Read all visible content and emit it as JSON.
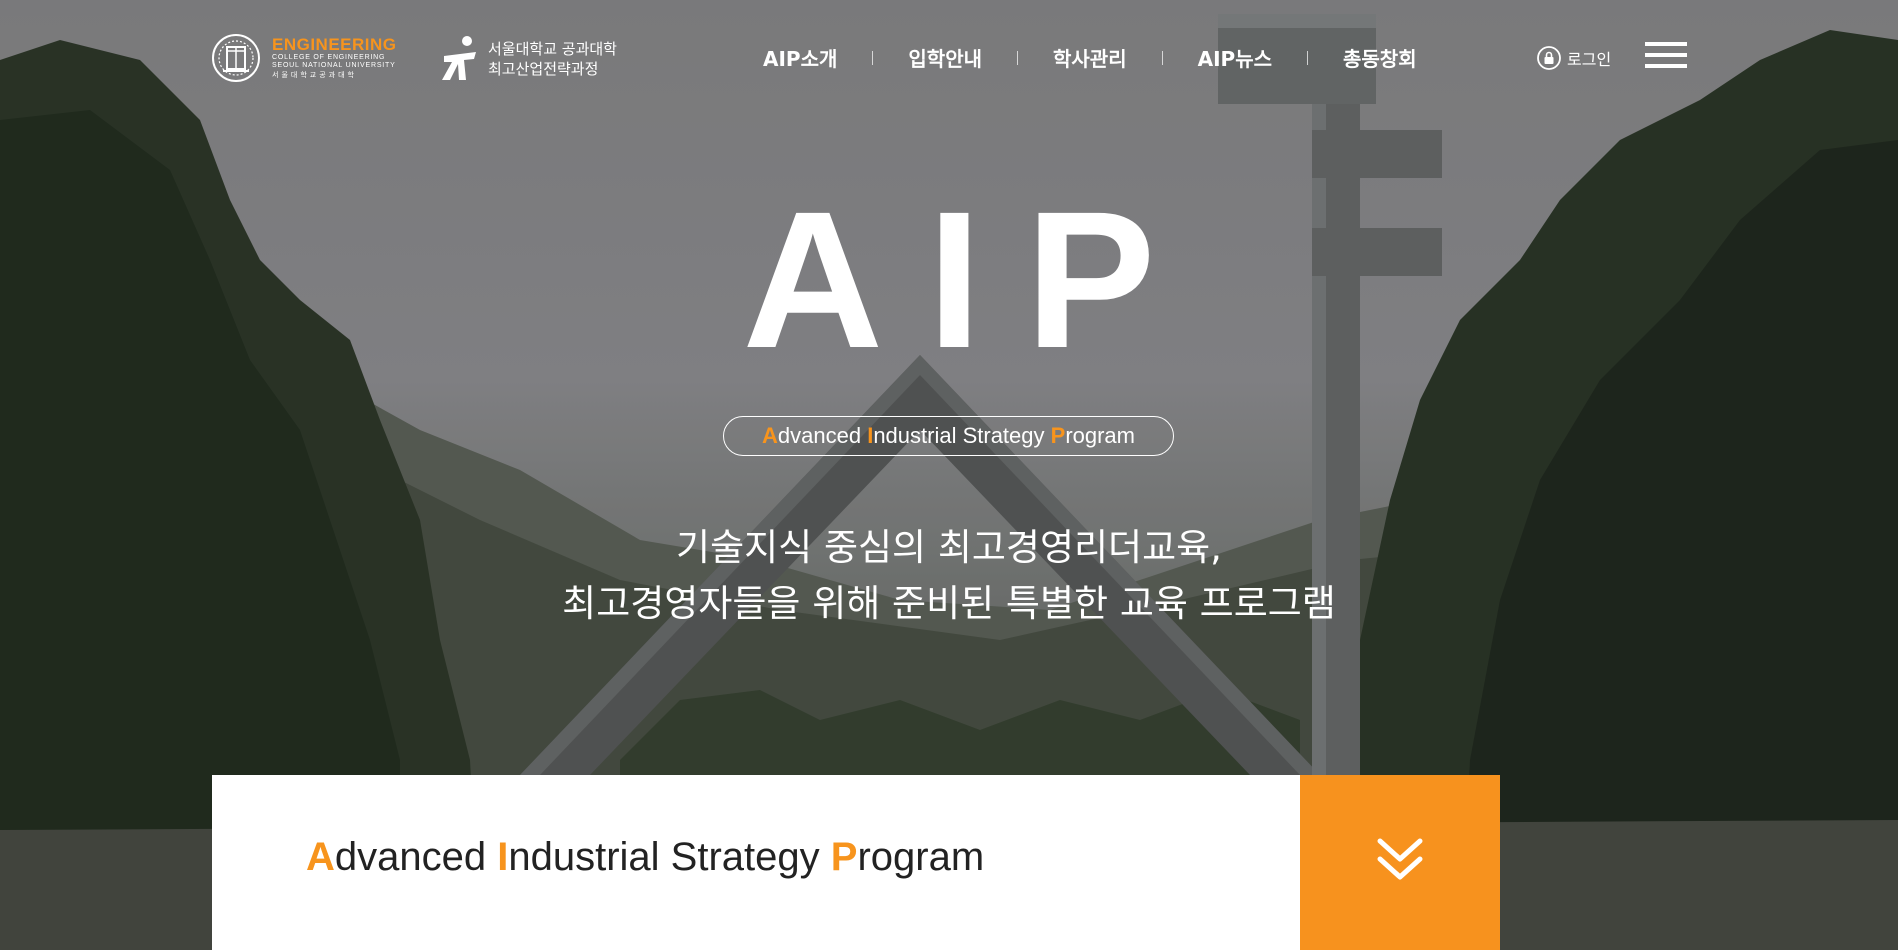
{
  "header": {
    "eng_logo": {
      "title": "ENGINEERING",
      "sub1": "COLLEGE OF ENGINEERING",
      "sub2": "SEOUL NATIONAL UNIVERSITY",
      "korean": "서울대학교공과대학"
    },
    "aip_logo": {
      "line1": "서울대학교 공과대학",
      "line2": "최고산업전략과정"
    },
    "nav": [
      "AIP소개",
      "입학안내",
      "학사관리",
      "AIP뉴스",
      "총동창회"
    ],
    "login_label": "로그인",
    "icons": {
      "login": "lock-icon",
      "menu": "hamburger-menu-icon"
    }
  },
  "hero": {
    "title": "AIP",
    "subtitle": {
      "parts": [
        {
          "t": "A",
          "hl": true
        },
        {
          "t": "dvanced ",
          "hl": false
        },
        {
          "t": "I",
          "hl": true
        },
        {
          "t": "ndustrial Strategy ",
          "hl": false
        },
        {
          "t": "P",
          "hl": true
        },
        {
          "t": "rogram",
          "hl": false
        }
      ]
    },
    "tagline_line1": "기술지식 중심의 최고경영리더교육,",
    "tagline_line2": "최고경영자들을 위해 준비된 특별한 교육 프로그램"
  },
  "bottom": {
    "title": {
      "parts": [
        {
          "t": "A",
          "hl": true
        },
        {
          "t": "dvanced ",
          "hl": false
        },
        {
          "t": "I",
          "hl": true
        },
        {
          "t": "ndustrial ",
          "hl": false
        },
        {
          "t": "S",
          "hl": false
        },
        {
          "t": "trategy ",
          "hl": false
        },
        {
          "t": "P",
          "hl": true
        },
        {
          "t": "rogram",
          "hl": false
        }
      ]
    },
    "scroll_icon": "double-chevron-down-icon"
  },
  "colors": {
    "accent": "#f7941d",
    "white": "#ffffff",
    "text_dark": "#222222"
  }
}
